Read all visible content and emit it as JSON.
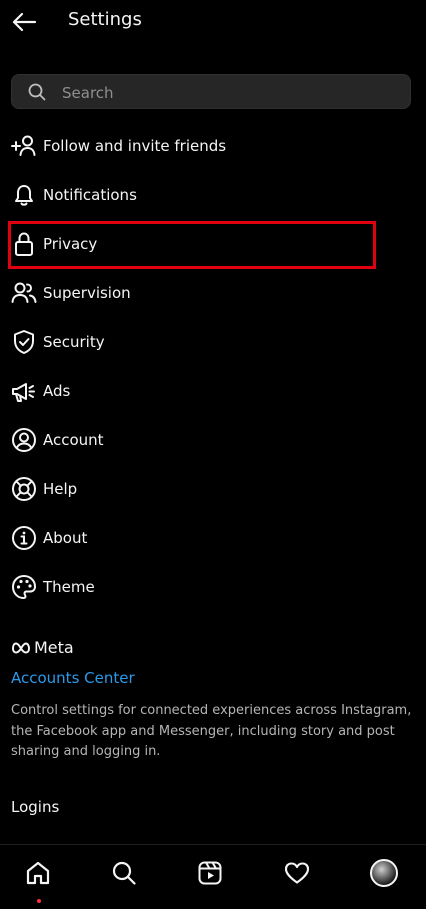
{
  "header": {
    "title": "Settings"
  },
  "search": {
    "placeholder": "Search"
  },
  "menu": {
    "items": [
      {
        "label": "Follow and invite friends",
        "icon": "add-person-icon"
      },
      {
        "label": "Notifications",
        "icon": "bell-icon"
      },
      {
        "label": "Privacy",
        "icon": "lock-icon"
      },
      {
        "label": "Supervision",
        "icon": "people-icon"
      },
      {
        "label": "Security",
        "icon": "shield-check-icon"
      },
      {
        "label": "Ads",
        "icon": "megaphone-icon"
      },
      {
        "label": "Account",
        "icon": "person-circle-icon"
      },
      {
        "label": "Help",
        "icon": "lifebuoy-icon"
      },
      {
        "label": "About",
        "icon": "info-icon"
      },
      {
        "label": "Theme",
        "icon": "palette-icon"
      }
    ]
  },
  "meta": {
    "brand": "Meta",
    "accounts_center": "Accounts Center",
    "description": "Control settings for connected experiences across Instagram,  the Facebook app and Messenger,  including story and post sharing and logging in."
  },
  "logins": {
    "label": "Logins"
  },
  "highlight": {
    "color": "#e0000f",
    "target": "Privacy"
  },
  "colors": {
    "background": "#000000",
    "accent_link": "#2b9ae8",
    "search_bg": "#262626"
  },
  "bottom_nav": {
    "items": [
      {
        "icon": "home-icon",
        "active": true
      },
      {
        "icon": "search-icon"
      },
      {
        "icon": "reels-icon"
      },
      {
        "icon": "heart-icon"
      },
      {
        "icon": "profile-avatar"
      }
    ]
  }
}
